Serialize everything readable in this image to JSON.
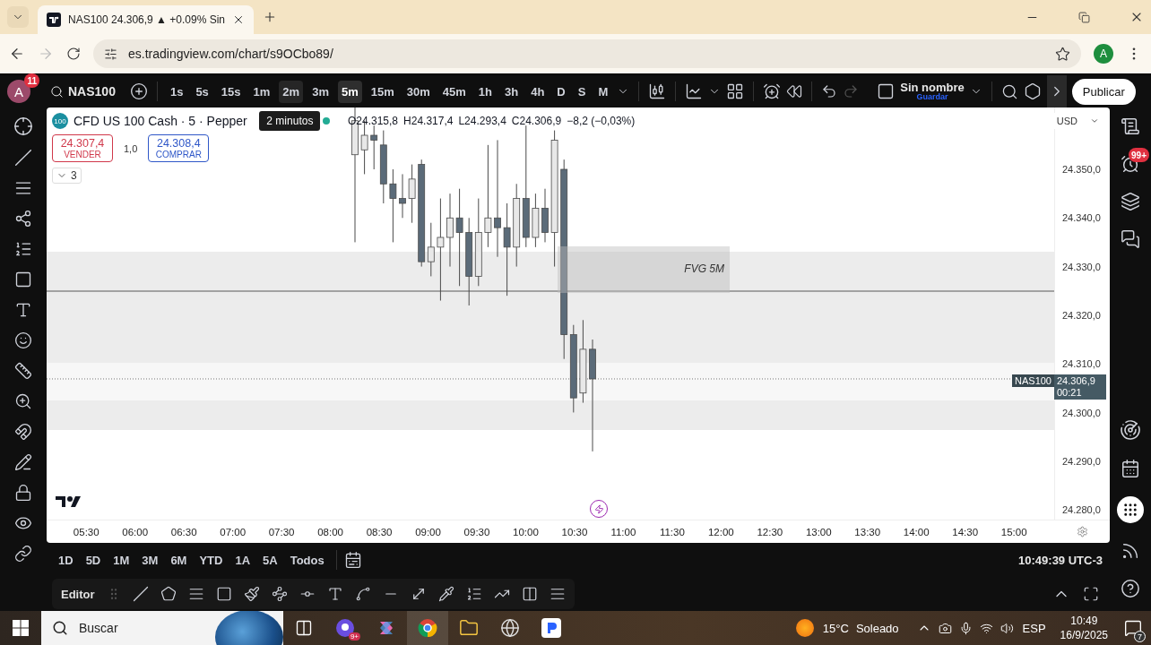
{
  "browser": {
    "tab": {
      "title": "NAS100 24.306,9 ▲ +0.09% Sin",
      "selected": true
    },
    "address": "es.tradingview.com/chart/s9OCbo89/",
    "profile": "A",
    "forward_disabled": true
  },
  "toolbar": {
    "avatar": "A",
    "notifications": "11",
    "symbol": "NAS100",
    "intervals": [
      {
        "label": "1s",
        "selected": false,
        "hovered": false
      },
      {
        "label": "5s",
        "selected": false,
        "hovered": false
      },
      {
        "label": "15s",
        "selected": false,
        "hovered": false
      },
      {
        "label": "1m",
        "selected": false,
        "hovered": false
      },
      {
        "label": "2m",
        "selected": false,
        "hovered": true
      },
      {
        "label": "3m",
        "selected": false,
        "hovered": false
      },
      {
        "label": "5m",
        "selected": true,
        "hovered": false
      },
      {
        "label": "15m",
        "selected": false,
        "hovered": false
      },
      {
        "label": "30m",
        "selected": false,
        "hovered": false
      },
      {
        "label": "45m",
        "selected": false,
        "hovered": false
      },
      {
        "label": "1h",
        "selected": false,
        "hovered": false
      },
      {
        "label": "3h",
        "selected": false,
        "hovered": false
      },
      {
        "label": "4h",
        "selected": false,
        "hovered": false
      },
      {
        "label": "D",
        "selected": false,
        "hovered": false
      },
      {
        "label": "S",
        "selected": false,
        "hovered": false
      },
      {
        "label": "M",
        "selected": false,
        "hovered": false
      }
    ],
    "tooltip": "2 minutos",
    "layout_name": "Sin nombre",
    "save_label": "Guardar",
    "publish": "Publicar"
  },
  "legend": {
    "badge": "100",
    "title": "CFD US 100 Cash · 5 · Pepper",
    "ohlc": [
      "O24.315,8",
      "H24.317,4",
      "L24.293,4",
      "C24.306,9"
    ],
    "change": "−8,2 (−0,03%)",
    "sell": {
      "price": "24.307,4",
      "label": "VENDER"
    },
    "quantity": "1,0",
    "buy": {
      "price": "24.308,4",
      "label": "COMPRAR"
    },
    "indicators_count": "3"
  },
  "chart": {
    "currency": "USD",
    "zone_label": "FVG 5M",
    "price_labels": [
      "24.350,0",
      "24.340,0",
      "24.330,0",
      "24.320,0",
      "24.310,0",
      "24.300,0",
      "24.290,0",
      "24.280,0"
    ],
    "time_labels": [
      "05:30",
      "06:00",
      "06:30",
      "07:00",
      "07:30",
      "08:00",
      "08:30",
      "09:00",
      "09:30",
      "10:00",
      "10:30",
      "11:00",
      "11:30",
      "12:00",
      "12:30",
      "13:00",
      "13:30",
      "14:00",
      "14:30",
      "15:00"
    ],
    "price_tag": {
      "symbol": "NAS100",
      "price": "24.306,9",
      "countdown": "00:21"
    }
  },
  "sidebar": {
    "alerts_badge": "99+"
  },
  "ranges": [
    "1D",
    "5D",
    "1M",
    "3M",
    "6M",
    "YTD",
    "1A",
    "5A",
    "Todos"
  ],
  "clock": "10:49:39 UTC-3",
  "editor": {
    "label": "Editor"
  },
  "taskbar": {
    "search_placeholder": "Buscar",
    "app_badge": "9+",
    "temperature": "15°C",
    "condition": "Soleado",
    "language": "ESP",
    "time": "10:49",
    "date": "16/9/2025",
    "notifications": "7"
  }
}
